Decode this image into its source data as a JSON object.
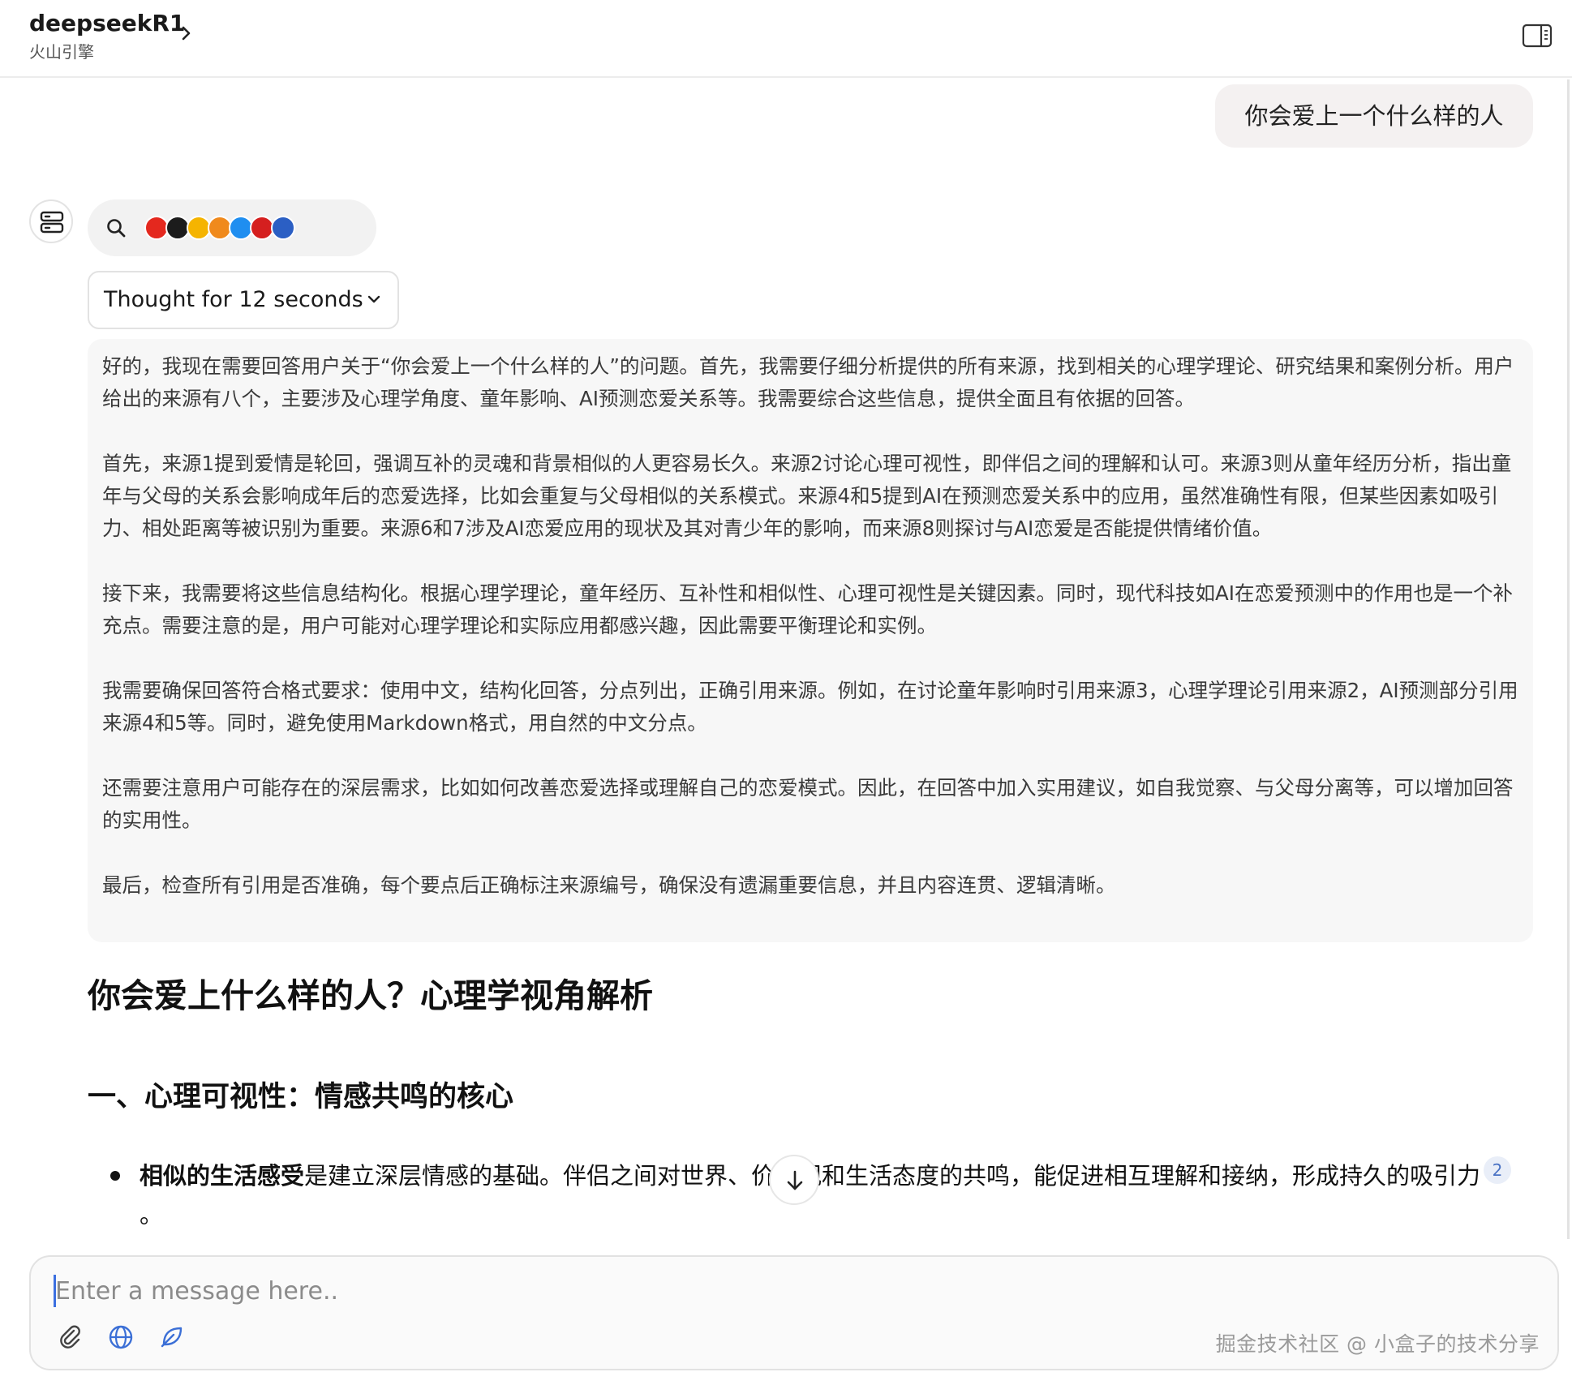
{
  "header": {
    "model_name": "deepseekR1",
    "provider": "火山引擎"
  },
  "user_message": "你会爱上一个什么样的人",
  "search": {
    "icon": "search-icon",
    "sources": [
      "#e4281e",
      "#1c1c1c",
      "#f5b400",
      "#f08a1c",
      "#1f8ef0",
      "#d51f1f",
      "#2b5fc4"
    ]
  },
  "thought": {
    "label": "Thought for 12 seconds",
    "paragraphs": [
      "好的，我现在需要回答用户关于“你会爱上一个什么样的人”的问题。首先，我需要仔细分析提供的所有来源，找到相关的心理学理论、研究结果和案例分析。用户给出的来源有八个，主要涉及心理学角度、童年影响、AI预测恋爱关系等。我需要综合这些信息，提供全面且有依据的回答。",
      "首先，来源1提到爱情是轮回，强调互补的灵魂和背景相似的人更容易长久。来源2讨论心理可视性，即伴侣之间的理解和认可。来源3则从童年经历分析，指出童年与父母的关系会影响成年后的恋爱选择，比如会重复与父母相似的关系模式。来源4和5提到AI在预测恋爱关系中的应用，虽然准确性有限，但某些因素如吸引力、相处距离等被识别为重要。来源6和7涉及AI恋爱应用的现状及其对青少年的影响，而来源8则探讨与AI恋爱是否能提供情绪价值。",
      "接下来，我需要将这些信息结构化。根据心理学理论，童年经历、互补性和相似性、心理可视性是关键因素。同时，现代科技如AI在恋爱预测中的作用也是一个补充点。需要注意的是，用户可能对心理学理论和实际应用都感兴趣，因此需要平衡理论和实例。",
      "我需要确保回答符合格式要求：使用中文，结构化回答，分点列出，正确引用来源。例如，在讨论童年影响时引用来源3，心理学理论引用来源2，AI预测部分引用来源4和5等。同时，避免使用Markdown格式，用自然的中文分点。",
      "还需要注意用户可能存在的深层需求，比如如何改善恋爱选择或理解自己的恋爱模式。因此，在回答中加入实用建议，如自我觉察、与父母分离等，可以增加回答的实用性。",
      "最后，检查所有引用是否准确，每个要点后正确标注来源编号，确保没有遗漏重要信息，并且内容连贯、逻辑清晰。"
    ]
  },
  "answer": {
    "title": "你会爱上什么样的人？心理学视角解析",
    "section1_title": "一、心理可视性：情感共鸣的核心",
    "bullet1_bold": "相似的生活感受",
    "bullet1_text": "是建立深层情感的基础。伴侣之间对世界、价值观和生活态度的共鸣，能促进相互理解和接纳，形成持久的吸引力",
    "bullet1_cite": "2",
    "bullet1_end": "。"
  },
  "composer": {
    "placeholder": "Enter a message here..",
    "watermark": "掘金技术社区 @ 小盒子的技术分享"
  }
}
